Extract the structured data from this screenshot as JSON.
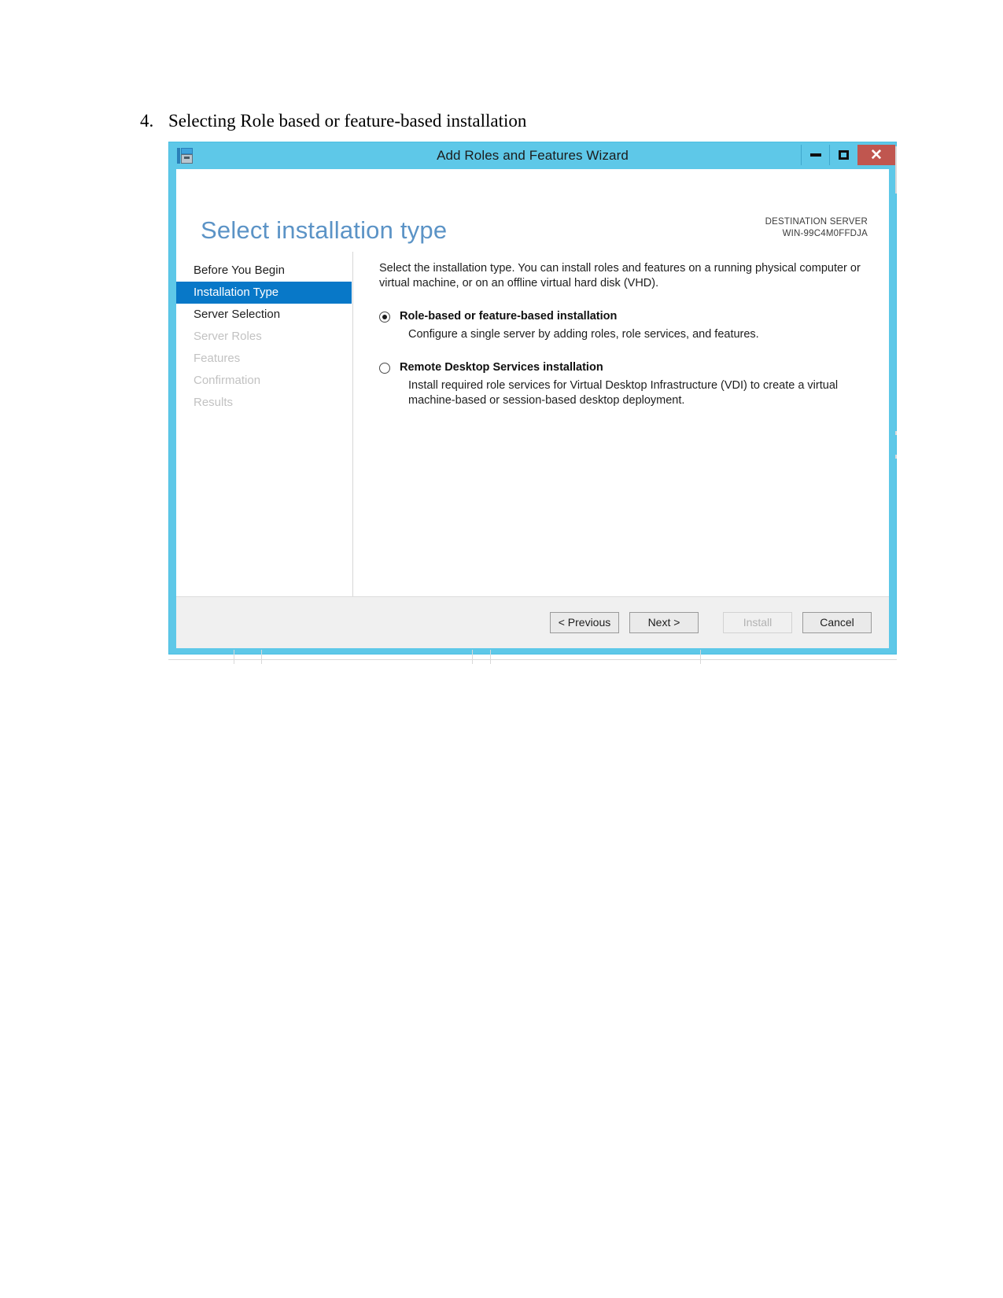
{
  "document": {
    "step_number": "4.",
    "step_text": "Selecting Role based or feature-based installation"
  },
  "window": {
    "title": "Add Roles and Features Wizard",
    "icon": "server-tools-icon",
    "controls": {
      "minimize": "—",
      "maximize": "□",
      "close": "✕"
    },
    "colors": {
      "titlebar": "#5ec8e8",
      "close_button": "#c0564f",
      "nav_selected": "#0878c8",
      "page_title": "#5b93c6"
    }
  },
  "header": {
    "page_title": "Select installation type",
    "destination_label": "DESTINATION SERVER",
    "destination_server": "WIN-99C4M0FFDJA"
  },
  "nav": {
    "items": [
      {
        "label": "Before You Begin",
        "state": "enabled"
      },
      {
        "label": "Installation Type",
        "state": "selected"
      },
      {
        "label": "Server Selection",
        "state": "enabled"
      },
      {
        "label": "Server Roles",
        "state": "disabled"
      },
      {
        "label": "Features",
        "state": "disabled"
      },
      {
        "label": "Confirmation",
        "state": "disabled"
      },
      {
        "label": "Results",
        "state": "disabled"
      }
    ]
  },
  "content": {
    "intro": "Select the installation type. You can install roles and features on a running physical computer or virtual machine, or on an offline virtual hard disk (VHD).",
    "options": [
      {
        "title": "Role-based or feature-based installation",
        "description": "Configure a single server by adding roles, role services, and features.",
        "selected": true
      },
      {
        "title": "Remote Desktop Services installation",
        "description": "Install required role services for Virtual Desktop Infrastructure (VDI) to create a virtual machine-based or session-based desktop deployment.",
        "selected": false
      }
    ]
  },
  "footer": {
    "previous": "< Previous",
    "next": "Next >",
    "install": "Install",
    "cancel": "Cancel"
  }
}
